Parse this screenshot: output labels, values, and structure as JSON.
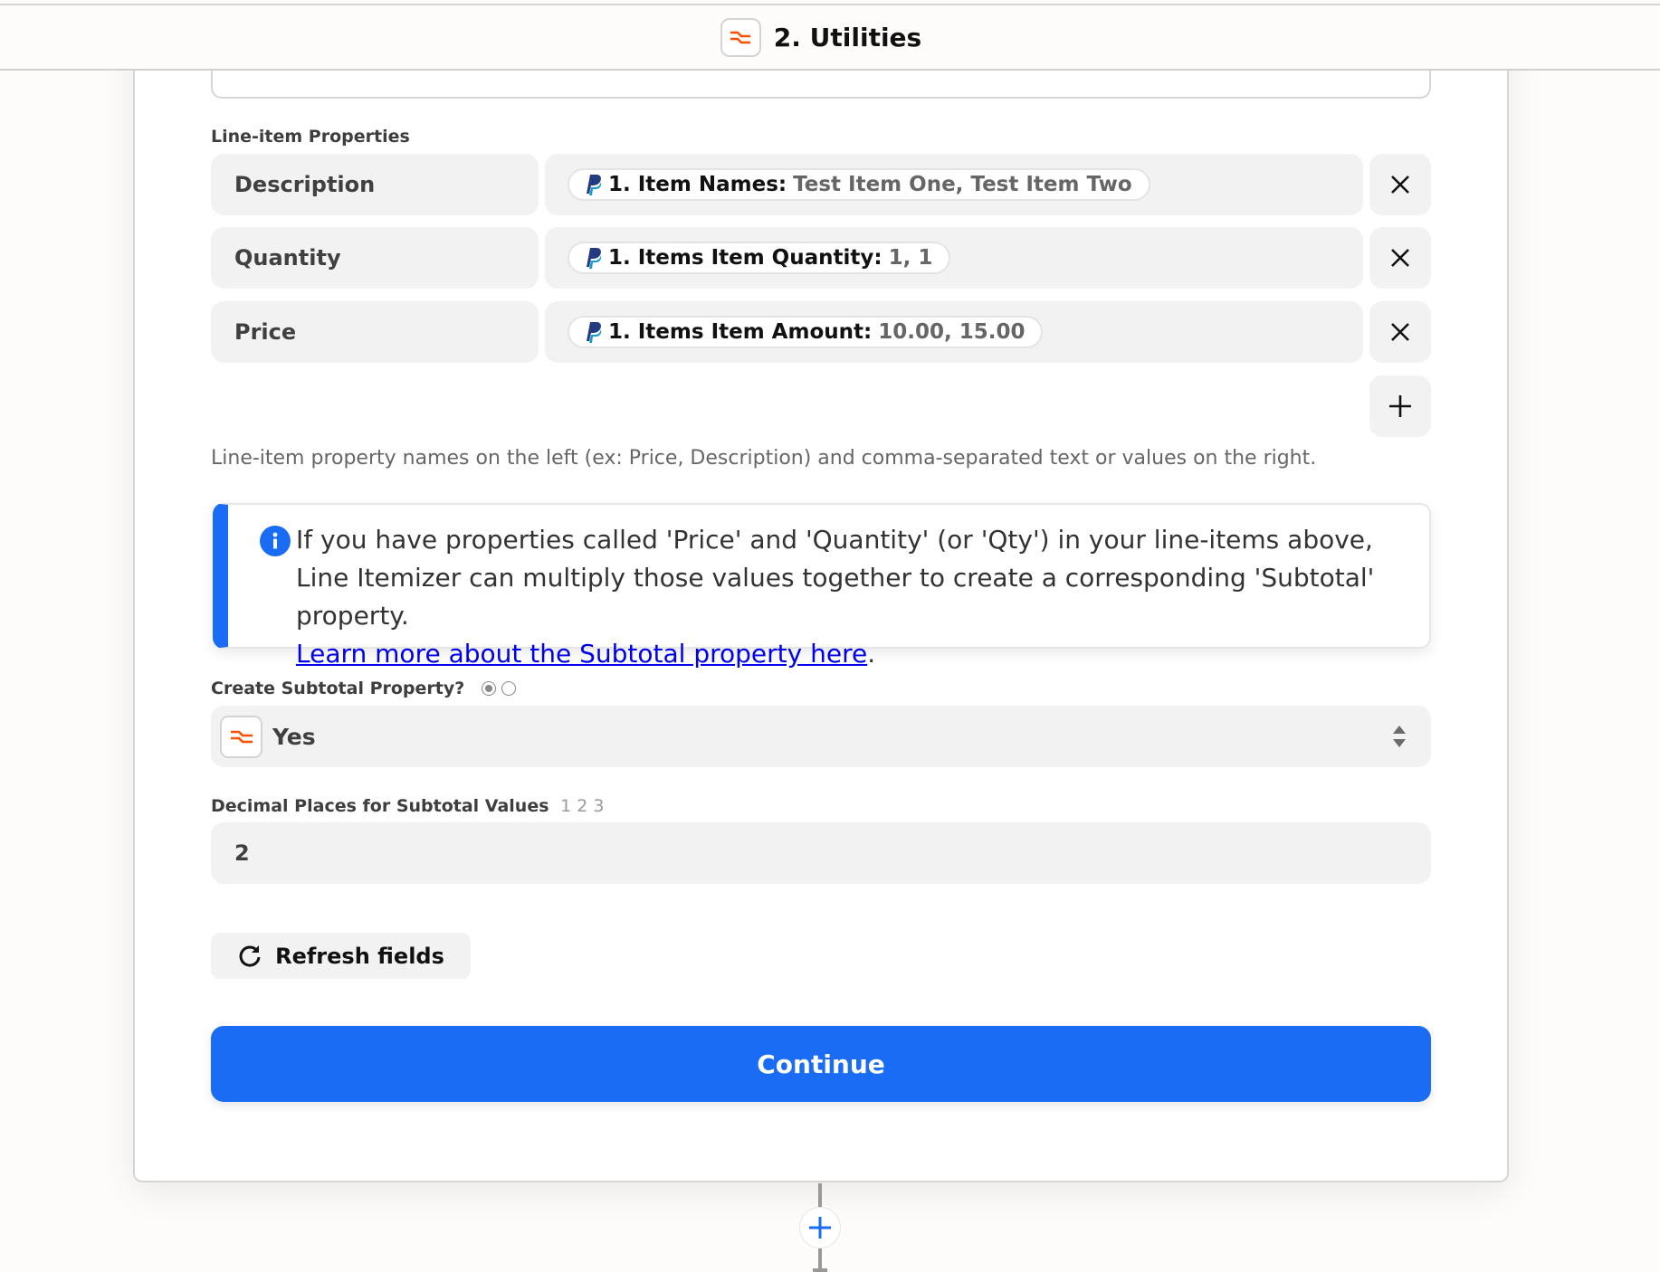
{
  "header": {
    "title": "2. Utilities",
    "icon": "utilities-icon",
    "icon_color": "#ff4f00"
  },
  "line_items": {
    "label": "Line-item Properties",
    "rows": [
      {
        "key": "Description",
        "source_icon": "paypal-icon",
        "field": "1. Item Names:",
        "value": "Test Item One, Test Item Two"
      },
      {
        "key": "Quantity",
        "source_icon": "paypal-icon",
        "field": "1. Items Item Quantity:",
        "value": "1, 1"
      },
      {
        "key": "Price",
        "source_icon": "paypal-icon",
        "field": "1. Items Item Amount:",
        "value": "10.00, 15.00"
      }
    ],
    "remove_icon": "close-icon",
    "add_icon": "plus-icon",
    "help_text": "Line-item property names on the left (ex: Price, Description) and comma-separated text or values on the right."
  },
  "info": {
    "icon": "info-icon",
    "text": "If you have properties called 'Price' and 'Quantity' (or 'Qty') in your line-items above, Line Itemizer can multiply those values together to create a corresponding 'Subtotal' property.",
    "link_text": "Learn more about the Subtotal property here",
    "trailing": ".",
    "accent_color": "#1a6cf4"
  },
  "subtotal": {
    "label": "Create Subtotal Property?",
    "type_hint": "radio",
    "selected": "Yes"
  },
  "decimal_places": {
    "label": "Decimal Places for Subtotal Values",
    "type_hint": "1 2 3",
    "value": "2"
  },
  "actions": {
    "refresh_label": "Refresh fields",
    "continue_label": "Continue",
    "continue_color": "#1a6cf4"
  }
}
